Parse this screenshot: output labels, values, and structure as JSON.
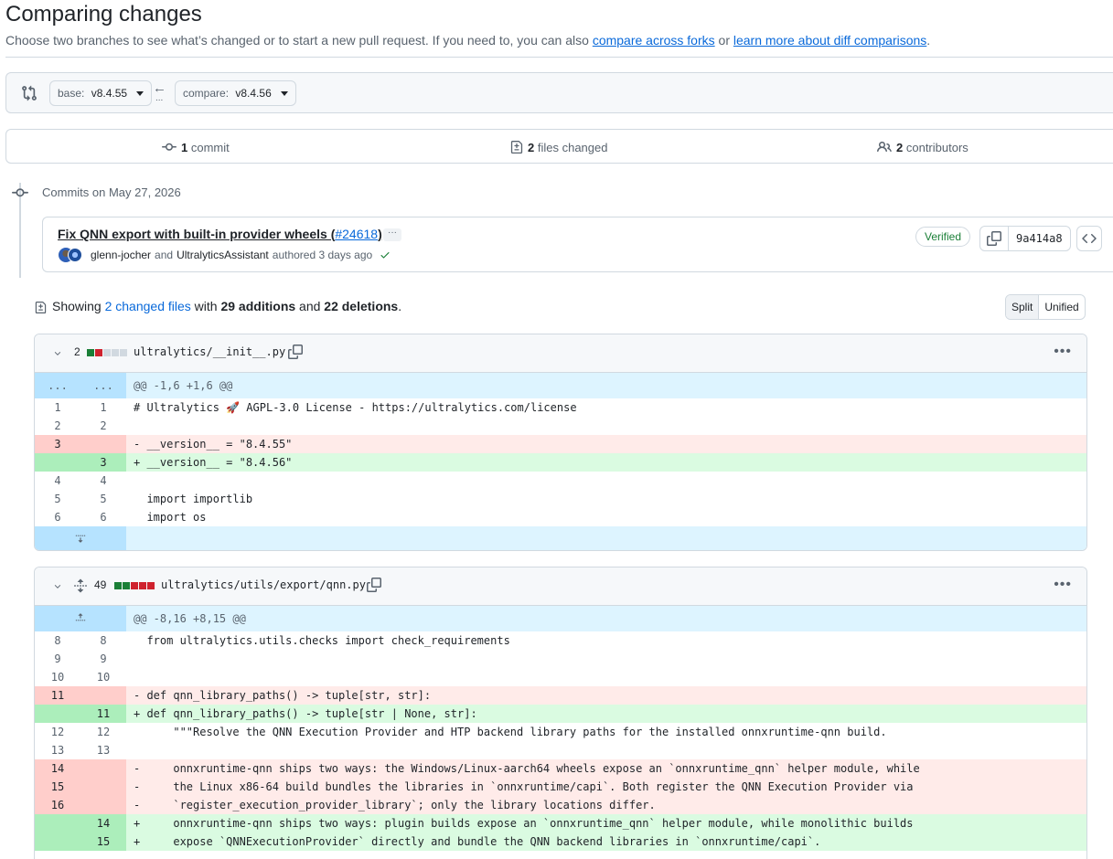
{
  "header": {
    "title": "Comparing changes",
    "desc_prefix": "Choose two branches to see what’s changed or to start a new pull request. If you need to, you can also ",
    "link_forks": "compare across forks",
    "desc_or": " or ",
    "link_learn": "learn more about diff comparisons",
    "desc_suffix": "."
  },
  "range": {
    "base_label": "base:",
    "base_value": "v8.4.55",
    "compare_label": "compare:",
    "compare_value": "v8.4.56",
    "arrow": "←",
    "dots": "..."
  },
  "summary": {
    "commits_count": "1",
    "commits_label": "commit",
    "files_count": "2",
    "files_label": "files changed",
    "contributors_count": "2",
    "contributors_label": "contributors"
  },
  "commits": {
    "date_heading": "Commits on May 27, 2026",
    "title": "Fix QNN export with built-in provider wheels (",
    "pr": "#24618",
    "title_end": ")",
    "more": "···",
    "author1": "glenn-jocher",
    "and": "and",
    "author2": "UltralyticsAssistant",
    "authored": "authored 3 days ago",
    "verified": "Verified",
    "sha": "9a414a8"
  },
  "toc": {
    "showing": "Showing ",
    "changed_files": "2 changed files",
    "with": " with ",
    "additions": "29 additions",
    "and": " and ",
    "deletions": "22 deletions",
    "end": ".",
    "split": "Split",
    "unified": "Unified"
  },
  "file1": {
    "count": "2",
    "name": "ultralytics/__init__.py",
    "diffstat": [
      "add",
      "del",
      "neutral",
      "neutral",
      "neutral"
    ],
    "hunk": "@@ -1,6 +1,6 @@",
    "hunk_dots": "...",
    "lines": [
      {
        "type": "ctx",
        "old": "1",
        "new": "1",
        "code": "# Ultralytics 🚀 AGPL-3.0 License - https://ultralytics.com/license"
      },
      {
        "type": "ctx",
        "old": "2",
        "new": "2",
        "code": ""
      },
      {
        "type": "del",
        "old": "3",
        "new": "",
        "code": "- __version__ = \"8.4.55\""
      },
      {
        "type": "add",
        "old": "",
        "new": "3",
        "code": "+ __version__ = \"8.4.56\""
      },
      {
        "type": "ctx",
        "old": "4",
        "new": "4",
        "code": ""
      },
      {
        "type": "ctx",
        "old": "5",
        "new": "5",
        "code": "  import importlib"
      },
      {
        "type": "ctx",
        "old": "6",
        "new": "6",
        "code": "  import os"
      }
    ]
  },
  "file2": {
    "count": "49",
    "name": "ultralytics/utils/export/qnn.py",
    "diffstat": [
      "add",
      "add",
      "del",
      "del",
      "del"
    ],
    "hunk": "@@ -8,16 +8,15 @@",
    "lines": [
      {
        "type": "ctx",
        "old": "8",
        "new": "8",
        "code": "  from ultralytics.utils.checks import check_requirements"
      },
      {
        "type": "ctx",
        "old": "9",
        "new": "9",
        "code": ""
      },
      {
        "type": "ctx",
        "old": "10",
        "new": "10",
        "code": ""
      },
      {
        "type": "del",
        "old": "11",
        "new": "",
        "code": "- def qnn_library_paths() -> tuple[str, str]:"
      },
      {
        "type": "add",
        "old": "",
        "new": "11",
        "code": "+ def qnn_library_paths() -> tuple[str | None, str]:"
      },
      {
        "type": "ctx",
        "old": "12",
        "new": "12",
        "code": "      \"\"\"Resolve the QNN Execution Provider and HTP backend library paths for the installed onnxruntime-qnn build."
      },
      {
        "type": "ctx",
        "old": "13",
        "new": "13",
        "code": ""
      },
      {
        "type": "del",
        "old": "14",
        "new": "",
        "code": "-     onnxruntime-qnn ships two ways: the Windows/Linux-aarch64 wheels expose an `onnxruntime_qnn` helper module, while"
      },
      {
        "type": "del",
        "old": "15",
        "new": "",
        "code": "-     the Linux x86-64 build bundles the libraries in `onnxruntime/capi`. Both register the QNN Execution Provider via"
      },
      {
        "type": "del",
        "old": "16",
        "new": "",
        "code": "-     `register_execution_provider_library`; only the library locations differ."
      },
      {
        "type": "add",
        "old": "",
        "new": "14",
        "code": "+     onnxruntime-qnn ships two ways: plugin builds expose an `onnxruntime_qnn` helper module, while monolithic builds"
      },
      {
        "type": "add",
        "old": "",
        "new": "15",
        "code": "+     expose `QNNExecutionProvider` directly and bundle the QNN backend libraries in `onnxruntime/capi`."
      }
    ]
  },
  "icons": {
    "compare": "git-compare-icon",
    "commit": "git-commit-icon",
    "file_diff": "file-diff-icon",
    "people": "people-icon",
    "copy": "copy-icon",
    "code": "code-icon",
    "check": "check-icon",
    "chevron": "chevron-down-icon",
    "kebab": "kebab-horizontal-icon",
    "unfold": "unfold-icon"
  },
  "colors": {
    "link": "#0969da",
    "add": "#1a7f37",
    "del": "#cf222e",
    "hunk_bg": "#ddf4ff"
  }
}
